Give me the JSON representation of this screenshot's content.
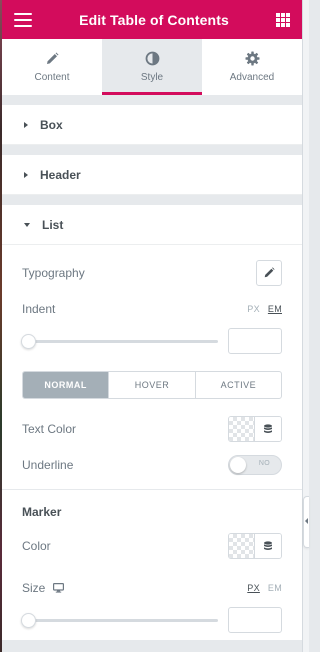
{
  "header": {
    "title": "Edit Table of Contents",
    "menu_icon": "hamburger-icon",
    "apps_icon": "grid-icon"
  },
  "tabs": [
    {
      "label": "Content",
      "icon": "pencil-icon",
      "active": false
    },
    {
      "label": "Style",
      "icon": "half-circle-icon",
      "active": true
    },
    {
      "label": "Advanced",
      "icon": "gear-icon",
      "active": false
    }
  ],
  "sections": {
    "box": {
      "label": "Box"
    },
    "header": {
      "label": "Header"
    },
    "list": {
      "label": "List",
      "typography_label": "Typography",
      "indent_label": "Indent",
      "indent_units": [
        "PX",
        "EM"
      ],
      "indent_unit_selected": "EM",
      "indent_value": "",
      "states": [
        "NORMAL",
        "HOVER",
        "ACTIVE"
      ],
      "state_selected": "NORMAL",
      "text_color_label": "Text Color",
      "underline_label": "Underline",
      "underline_toggle_text": "NO",
      "marker_label": "Marker",
      "color_label": "Color",
      "size_label": "Size",
      "size_units": [
        "PX",
        "EM"
      ],
      "size_unit_selected": "PX",
      "size_value": ""
    }
  },
  "colors": {
    "brand": "#d30c5c",
    "active_state": "#a4afb7"
  }
}
